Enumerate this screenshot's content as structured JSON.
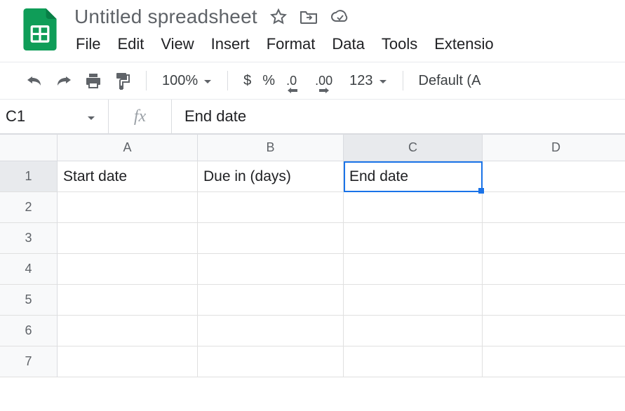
{
  "doc": {
    "title": "Untitled spreadsheet"
  },
  "menubar": [
    "File",
    "Edit",
    "View",
    "Insert",
    "Format",
    "Data",
    "Tools",
    "Extensio"
  ],
  "toolbar": {
    "zoom": "100%",
    "num_format": "123",
    "font": "Default (A"
  },
  "formula_bar": {
    "name_box": "C1",
    "fx": "fx",
    "value": "End date"
  },
  "columns": [
    "A",
    "B",
    "C",
    "D"
  ],
  "selected_col_index": 2,
  "rows": [
    1,
    2,
    3,
    4,
    5,
    6,
    7
  ],
  "selected_row_index": 0,
  "cells": {
    "A1": "Start date",
    "B1": "Due in (days)",
    "C1": "End date"
  },
  "icons": {
    "currency": "$",
    "percent": "%",
    "dec_dec": ".0",
    "inc_dec": ".00"
  }
}
